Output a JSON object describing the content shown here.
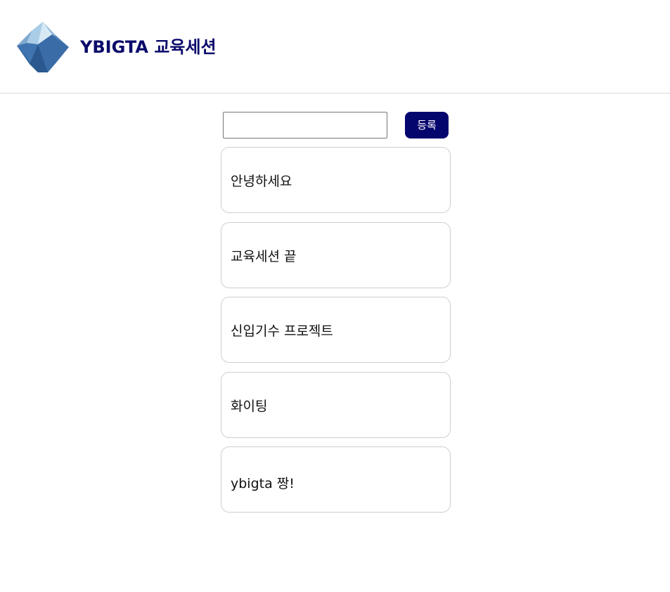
{
  "header": {
    "title": "YBIGTA 교육세션",
    "logo_icon": "iceberg-logo-icon"
  },
  "form": {
    "input_value": "",
    "submit_label": "등록"
  },
  "todos": [
    {
      "text": "안녕하세요"
    },
    {
      "text": "교육세션 끝"
    },
    {
      "text": "신입기수 프로젝트"
    },
    {
      "text": "화이팅"
    },
    {
      "text": "ybigta 짱!"
    }
  ],
  "colors": {
    "brand": "#05056e",
    "title": "#0a0a6b",
    "logo_dark": "#2e5f9e",
    "logo_light": "#a9cde6"
  }
}
